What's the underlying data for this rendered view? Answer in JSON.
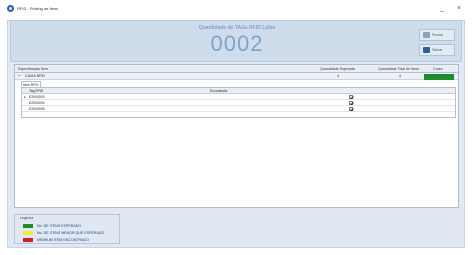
{
  "window": {
    "title": "RFID - Picking de Itens",
    "minimize_label": "_",
    "close_label": "×"
  },
  "header": {
    "title": "Quantidade de TAGs RFID Lidas",
    "count": "0002"
  },
  "actions": {
    "close_label": "Fechar",
    "save_label": "Salvar"
  },
  "grid": {
    "columns": {
      "description": "Especificação Item",
      "expected": "Quantidade Esperada",
      "total": "Quantidade Total de Itens",
      "color": "Cores"
    },
    "rows": [
      {
        "toggle": "−",
        "description": "CAIXA RFID",
        "expected": "4",
        "total": "4",
        "color": "#1f8a2b"
      }
    ],
    "detail_tab": "Item RFID",
    "detail_columns": {
      "tag": "Tag RFID",
      "found": "Encontrado"
    },
    "detail_rows": [
      {
        "rowhead": "▸",
        "tag": "E2004003",
        "found": true
      },
      {
        "rowhead": "",
        "tag": "E2004004",
        "found": true
      },
      {
        "rowhead": "",
        "tag": "E2004005",
        "found": true
      }
    ]
  },
  "legend": {
    "title": "Legenda",
    "items": [
      {
        "label": "No. DE ITENS ESPERADO",
        "color": "#1f8a2b"
      },
      {
        "label": "No. DE ITENS MENOR QUE ESPERADO",
        "color": "#f2ee2e"
      },
      {
        "label": "NENHUM ITEM ENCONTRADO",
        "color": "#d61f1f"
      }
    ]
  }
}
